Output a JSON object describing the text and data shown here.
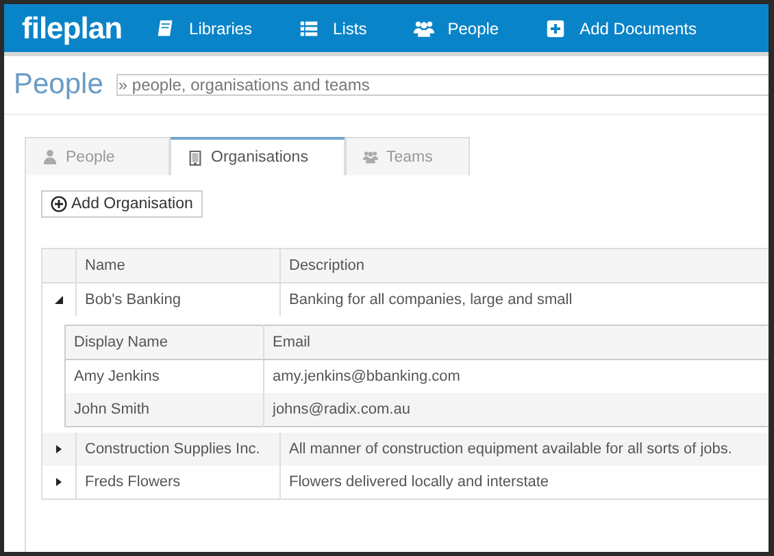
{
  "navbar": {
    "logo": "fileplan",
    "items": [
      {
        "label": "Libraries",
        "kind": "book"
      },
      {
        "label": "Lists",
        "kind": "list"
      },
      {
        "label": "People",
        "kind": "people"
      },
      {
        "label": "Add Documents",
        "kind": "plus"
      }
    ]
  },
  "header": {
    "title": "People",
    "subtitle": "» people, organisations and teams"
  },
  "tabs": [
    {
      "label": "People",
      "kind": "person",
      "selected": false
    },
    {
      "label": "Organisations",
      "kind": "building",
      "selected": true
    },
    {
      "label": "Teams",
      "kind": "people",
      "selected": false
    }
  ],
  "add_button": "Add Organisation",
  "table": {
    "columns": [
      "Name",
      "Description"
    ],
    "rows": [
      {
        "name": "Bob's Banking",
        "description": "Banking for all companies, large and small",
        "expanded": true,
        "members": {
          "columns": [
            "Display Name",
            "Email"
          ],
          "rows": [
            {
              "name": "Amy Jenkins",
              "email": "amy.jenkins@bbanking.com"
            },
            {
              "name": "John Smith",
              "email": "johns@radix.com.au"
            }
          ]
        }
      },
      {
        "name": "Construction Supplies Inc.",
        "description": "All manner of construction equipment available for all sorts of jobs.",
        "expanded": false
      },
      {
        "name": "Freds Flowers",
        "description": "Flowers delivered locally and interstate",
        "expanded": false
      }
    ]
  }
}
